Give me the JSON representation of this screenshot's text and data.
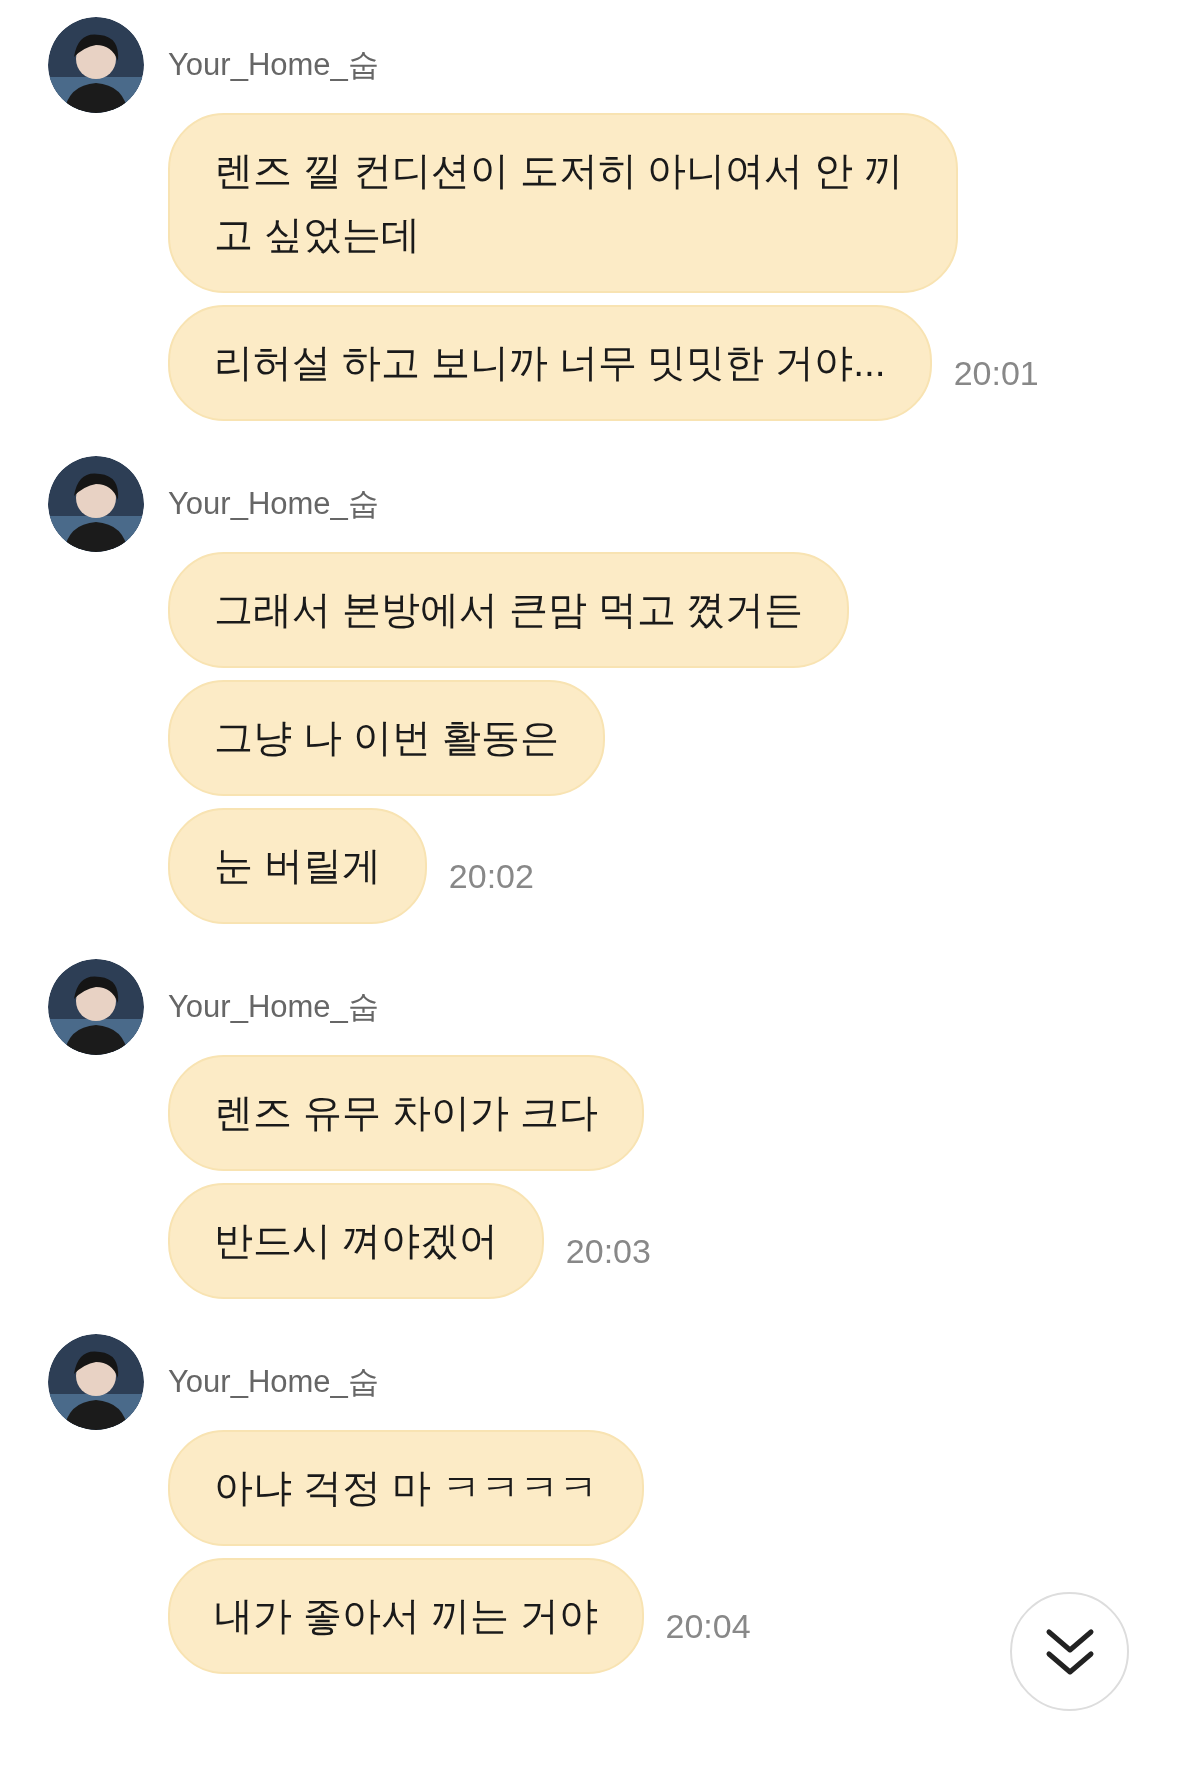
{
  "groups": [
    {
      "sender": "Your_Home_숩",
      "messages": [
        "렌즈 낄 컨디션이 도저히 아니여서 안 끼고 싶었는데",
        "리허설 하고 보니까 너무 밋밋한 거야..."
      ],
      "time": "20:01"
    },
    {
      "sender": "Your_Home_숩",
      "messages": [
        "그래서 본방에서 큰맘 먹고 꼈거든",
        "그냥 나 이번 활동은",
        "눈 버릴게"
      ],
      "time": "20:02"
    },
    {
      "sender": "Your_Home_숩",
      "messages": [
        "렌즈 유무 차이가 크다",
        "반드시 껴야겠어"
      ],
      "time": "20:03"
    },
    {
      "sender": "Your_Home_숩",
      "messages": [
        "아냐 걱정 마 ㅋㅋㅋㅋ",
        "내가 좋아서 끼는 거야"
      ],
      "time": "20:04"
    }
  ]
}
